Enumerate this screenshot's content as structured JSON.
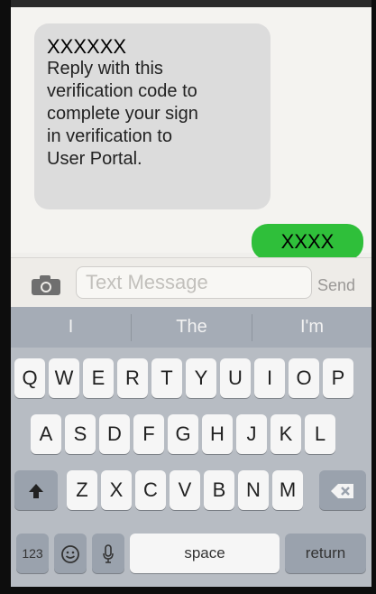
{
  "messages": {
    "incoming": {
      "code": "XXXXXX",
      "lines": [
        "Reply with this",
        "verification code to",
        "complete your sign",
        "in verification to",
        "User Portal."
      ]
    },
    "outgoing": {
      "text": "XXXX"
    }
  },
  "input_bar": {
    "placeholder": "Text Message",
    "send_label": "Send",
    "camera_icon": "camera-icon"
  },
  "suggestions": [
    "I",
    "The",
    "I'm"
  ],
  "keyboard": {
    "row1": [
      "Q",
      "W",
      "E",
      "R",
      "T",
      "Y",
      "U",
      "I",
      "O",
      "P"
    ],
    "row2": [
      "A",
      "S",
      "D",
      "F",
      "G",
      "H",
      "J",
      "K",
      "L"
    ],
    "row3": [
      "Z",
      "X",
      "C",
      "V",
      "B",
      "N",
      "M"
    ],
    "shift_icon": "shift-icon",
    "delete_icon": "delete-icon",
    "numbers_label": "123",
    "emoji_icon": "emoji-icon",
    "mic_icon": "microphone-icon",
    "space_label": "space",
    "return_label": "return"
  },
  "colors": {
    "outgoing_bubble": "#2fbf3a",
    "incoming_bubble": "#dcdcdc",
    "suggestion_bar": "#a5acb6",
    "keyboard_bg": "#b7bcc3"
  }
}
